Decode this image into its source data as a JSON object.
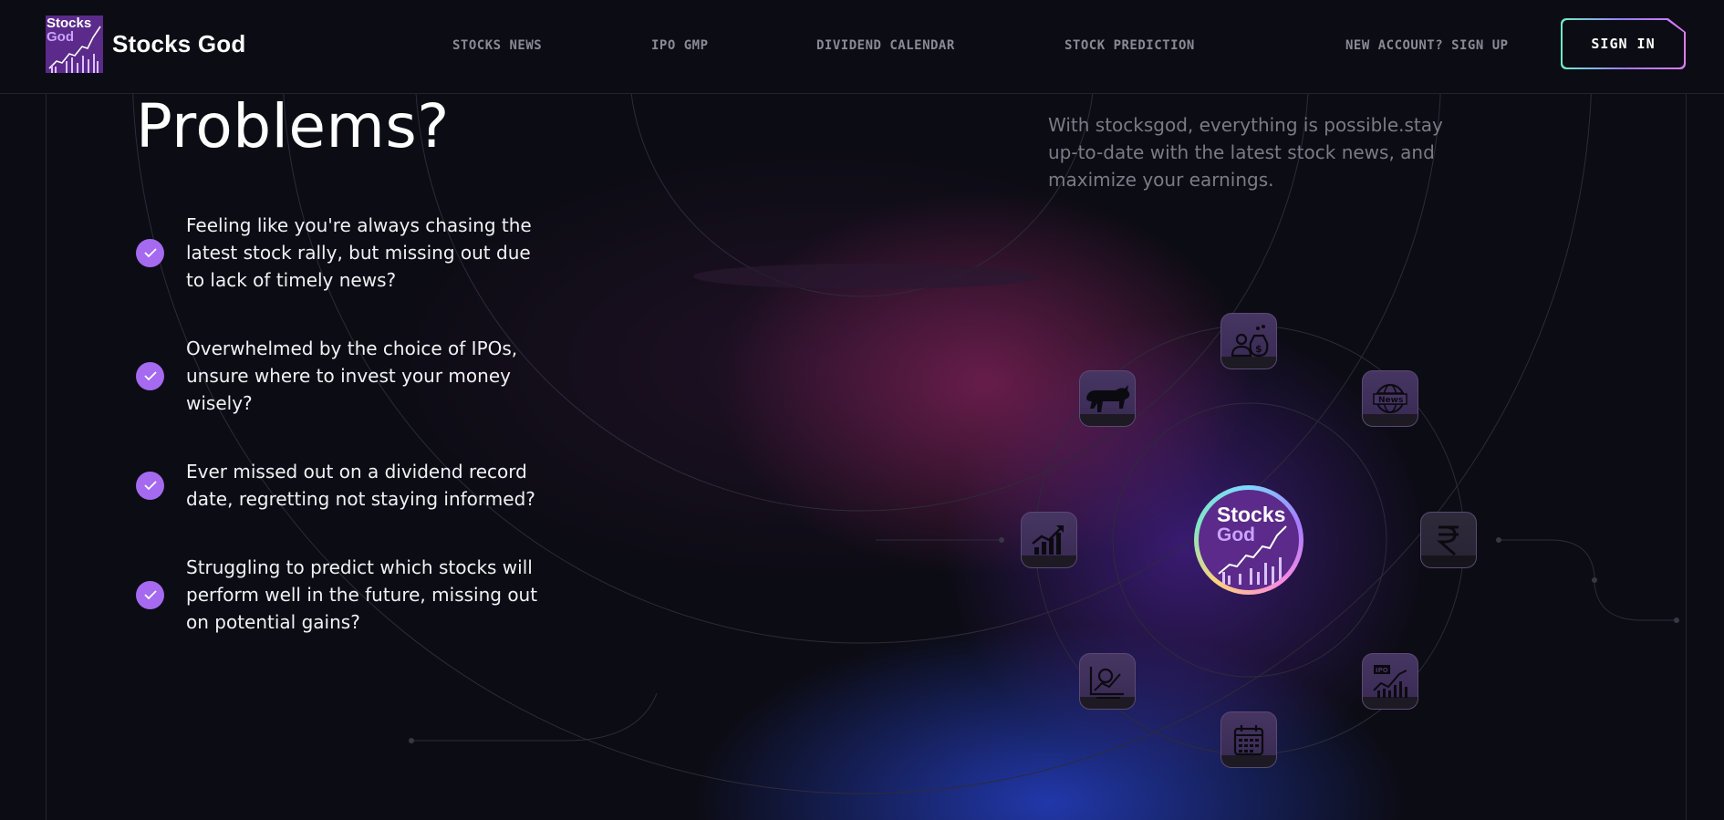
{
  "brand": {
    "name": "Stocks God",
    "logo_line1": "Stocks",
    "logo_line2": "God"
  },
  "nav": {
    "items": [
      "STOCKS NEWS",
      "IPO GMP",
      "DIVIDEND CALENDAR",
      "STOCK PREDICTION"
    ],
    "signup_label": "NEW ACCOUNT? SIGN UP",
    "signin_label": "SIGN IN"
  },
  "hero": {
    "heading": "Problems?",
    "intro": "With stocksgod, everything is possible.stay up-to-date with the latest stock news, and maximize your earnings.",
    "problems": [
      "Feeling like you're always chasing the latest stock rally, but missing out due to lack of timely news?",
      "Overwhelmed by the choice of IPOs, unsure where to invest your money wisely?",
      "Ever missed out on a dividend record date, regretting not staying informed?",
      "Struggling to predict which stocks will perform well in the future, missing out on potential gains?"
    ]
  },
  "diagram": {
    "center_line1": "Stocks",
    "center_line2": "God",
    "icons": [
      {
        "name": "bull-icon"
      },
      {
        "name": "investor-money-icon"
      },
      {
        "name": "news-globe-icon",
        "label": "News"
      },
      {
        "name": "growth-chart-icon"
      },
      {
        "name": "rupee-icon",
        "label": "₹"
      },
      {
        "name": "analysis-chart-icon"
      },
      {
        "name": "ipo-chart-icon",
        "label": "IPO"
      },
      {
        "name": "calendar-icon"
      }
    ]
  },
  "colors": {
    "accent": "#a56af0",
    "background": "#0c0c14",
    "muted_text": "#7c7a86",
    "nav_text": "#8a8a96"
  }
}
